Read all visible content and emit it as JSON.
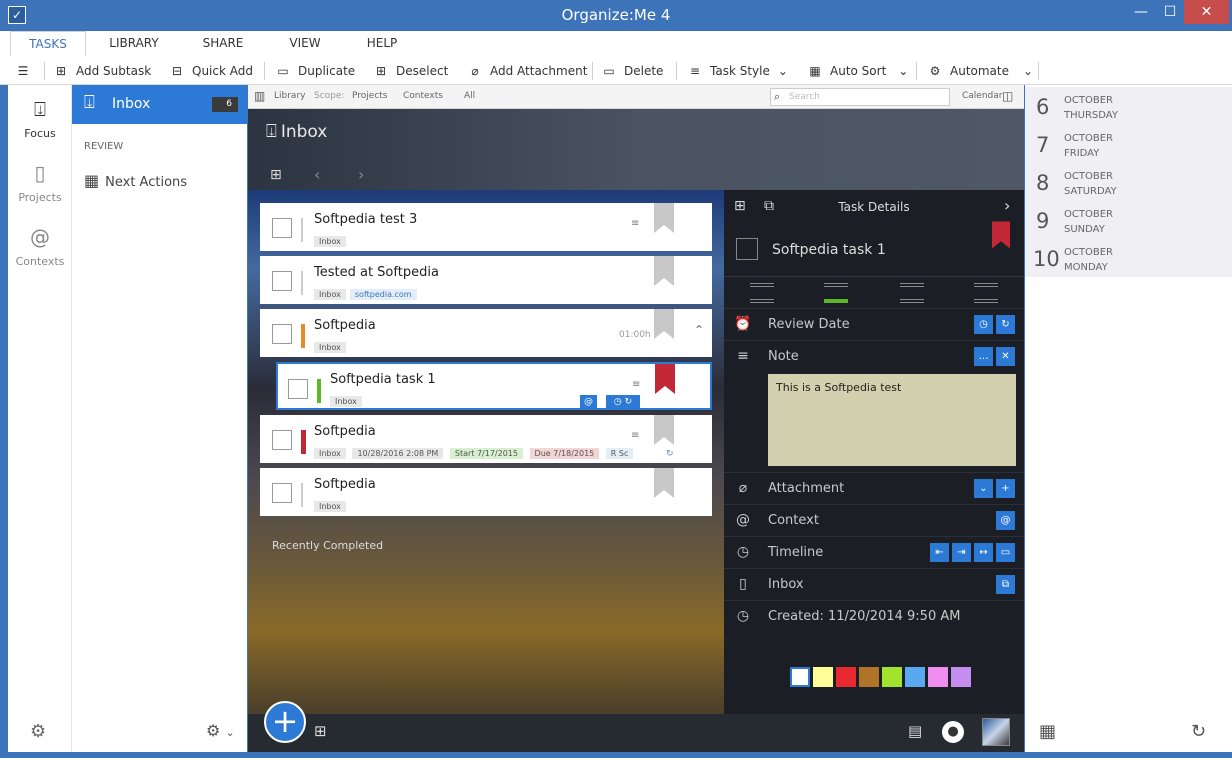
{
  "window": {
    "title": "Organize:Me 4",
    "minimize": "—",
    "maximize": "☐",
    "close": "✕"
  },
  "ribbon_tabs": [
    "TASKS",
    "LIBRARY",
    "SHARE",
    "VIEW",
    "HELP"
  ],
  "toolbar": {
    "add_subtask": "Add Subtask",
    "quick_add": "Quick Add",
    "duplicate": "Duplicate",
    "deselect": "Deselect",
    "add_attachment": "Add Attachment",
    "delete": "Delete",
    "task_style": "Task Style",
    "auto_sort": "Auto Sort",
    "automate": "Automate"
  },
  "nav": {
    "focus": "Focus",
    "projects": "Projects",
    "contexts": "Contexts"
  },
  "side": {
    "inbox": "Inbox",
    "inbox_count": "6",
    "review": "REVIEW",
    "next_actions": "Next Actions"
  },
  "subbar": {
    "library": "Library",
    "scope": "Scope:",
    "projects": "Projects",
    "contexts": "Contexts",
    "all": "All",
    "search_placeholder": "Search",
    "calendar": "Calendar"
  },
  "list_title": "Inbox",
  "tasks": [
    {
      "title": "Softpedia test 3",
      "tags": [
        "Inbox"
      ]
    },
    {
      "title": "Tested at Softpedia",
      "tags": [
        "Inbox",
        "softpedia.com"
      ]
    },
    {
      "title": "Softpedia",
      "tags": [
        "Inbox"
      ],
      "time": "01:00h"
    },
    {
      "title": "Softpedia task 1",
      "tags": [
        "Inbox"
      ]
    },
    {
      "title": "Softpedia",
      "tags": [
        "Inbox",
        "10/28/2016 2:08 PM",
        "Start 7/17/2015",
        "Due 7/18/2015",
        "R Sc"
      ]
    },
    {
      "title": "Softpedia",
      "tags": [
        "Inbox"
      ]
    }
  ],
  "recently_completed": "Recently Completed",
  "details": {
    "header": "Task Details",
    "task_title": "Softpedia task 1",
    "review_date": "Review Date",
    "note": "Note",
    "note_text": "This is a Softpedia test",
    "attachment": "Attachment",
    "context": "Context",
    "timeline": "Timeline",
    "project": "Inbox",
    "created": "Created: 11/20/2014 9:50 AM"
  },
  "colors": [
    "#ffffff",
    "#ffff99",
    "#e8292f",
    "#b07428",
    "#a2e32e",
    "#5aa8f0",
    "#f08ef0",
    "#c48ef0"
  ],
  "calendar": [
    {
      "day": "6",
      "month": "OCTOBER",
      "weekday": "THURSDAY"
    },
    {
      "day": "7",
      "month": "OCTOBER",
      "weekday": "FRIDAY"
    },
    {
      "day": "8",
      "month": "OCTOBER",
      "weekday": "SATURDAY"
    },
    {
      "day": "9",
      "month": "OCTOBER",
      "weekday": "SUNDAY"
    },
    {
      "day": "10",
      "month": "OCTOBER",
      "weekday": "MONDAY"
    }
  ]
}
